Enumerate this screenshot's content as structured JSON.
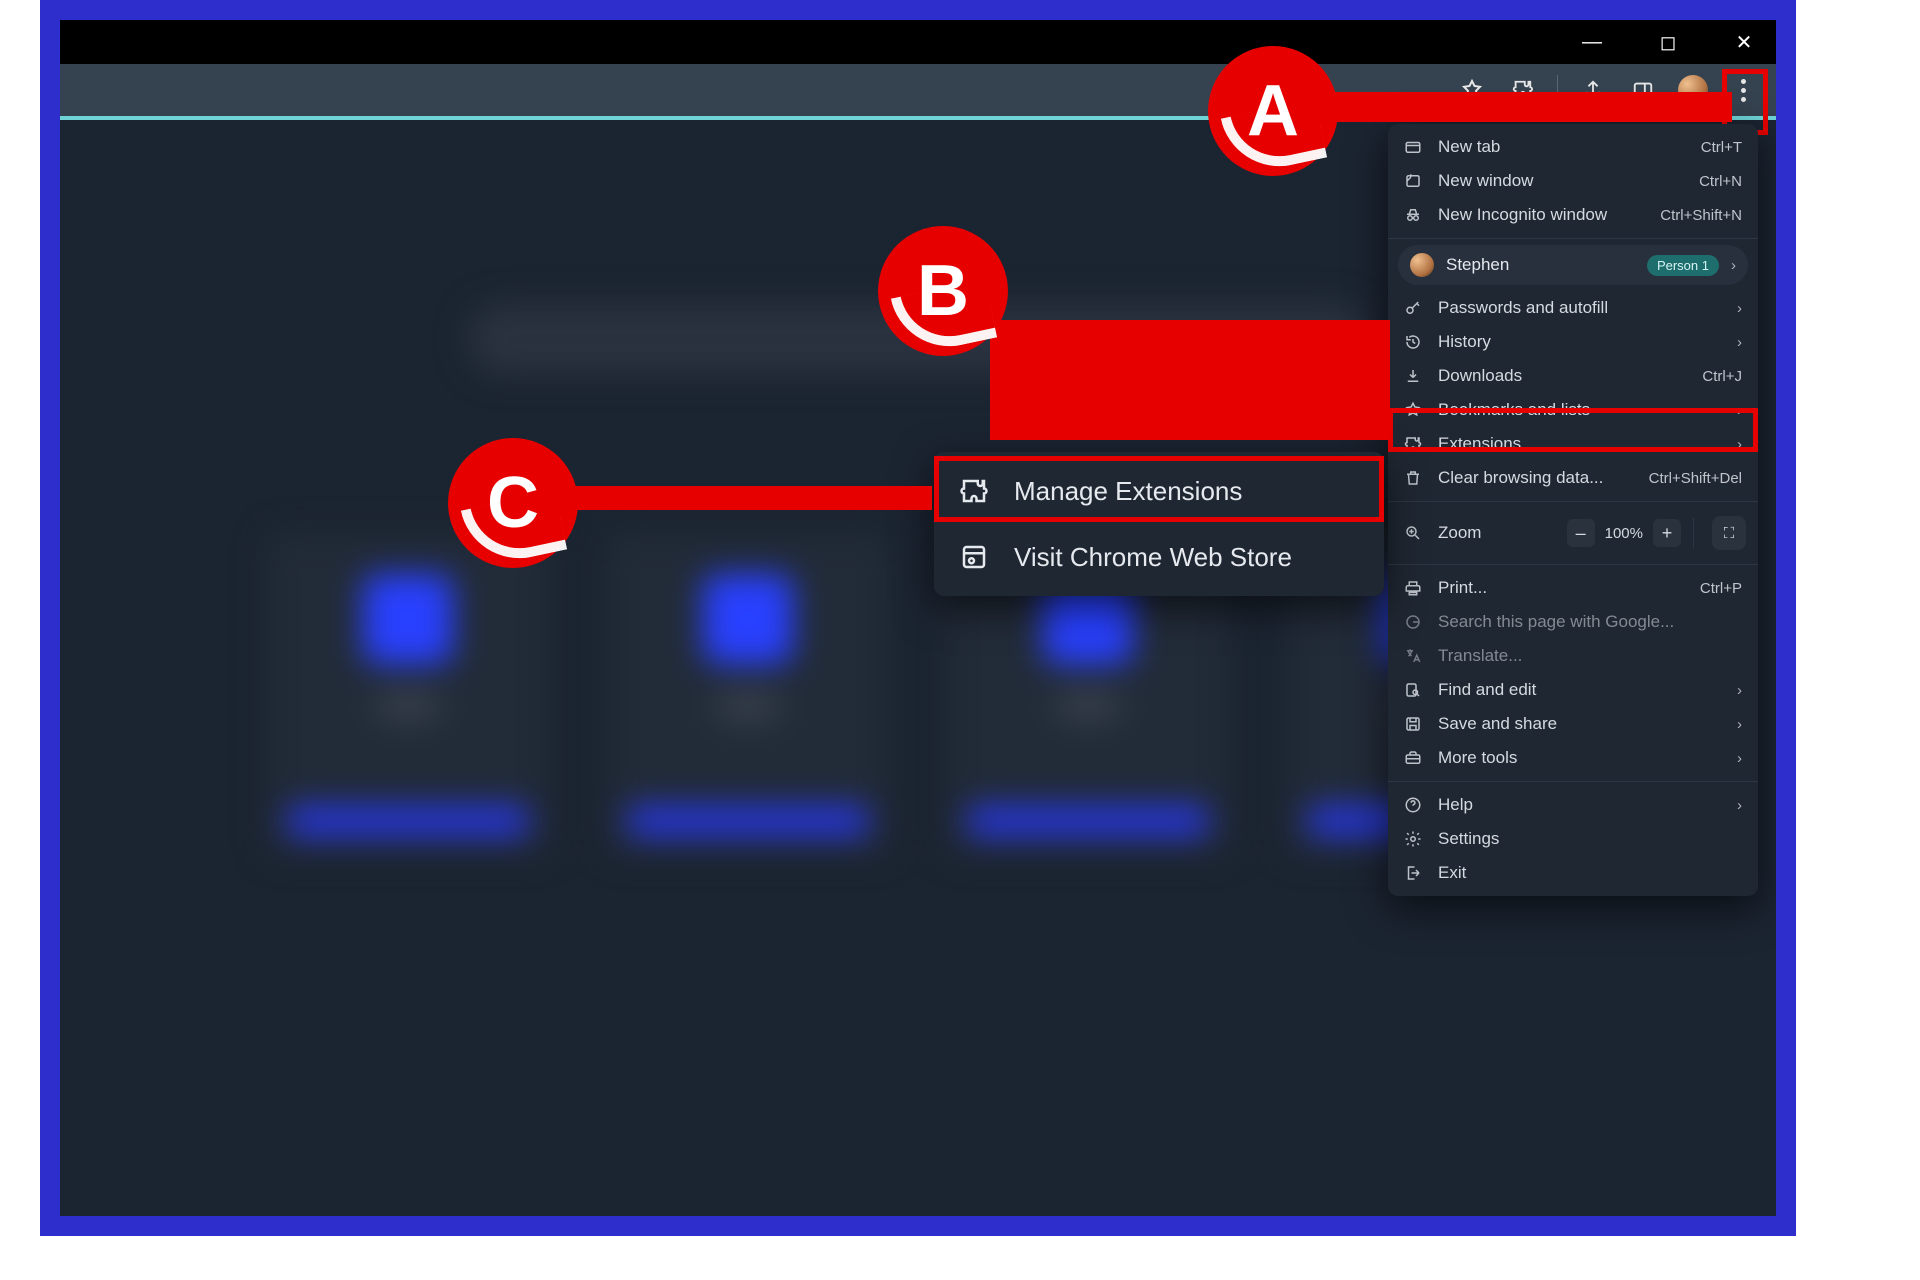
{
  "window_controls": {
    "min": "—",
    "max": "◻",
    "close": "✕"
  },
  "callouts": {
    "a": "A",
    "b": "B",
    "c": "C"
  },
  "submenu": {
    "manage": "Manage Extensions",
    "store": "Visit Chrome Web Store"
  },
  "profile": {
    "name": "Stephen",
    "badge": "Person 1"
  },
  "zoom": {
    "label": "Zoom",
    "value": "100%",
    "minus": "–",
    "plus": "+"
  },
  "menu": {
    "new_tab": {
      "label": "New tab",
      "shortcut": "Ctrl+T"
    },
    "new_window": {
      "label": "New window",
      "shortcut": "Ctrl+N"
    },
    "incognito": {
      "label": "New Incognito window",
      "shortcut": "Ctrl+Shift+N"
    },
    "passwords": {
      "label": "Passwords and autofill"
    },
    "history": {
      "label": "History"
    },
    "downloads": {
      "label": "Downloads",
      "shortcut": "Ctrl+J"
    },
    "bookmarks": {
      "label": "Bookmarks and lists"
    },
    "extensions": {
      "label": "Extensions"
    },
    "clear": {
      "label": "Clear browsing data...",
      "shortcut": "Ctrl+Shift+Del"
    },
    "print": {
      "label": "Print...",
      "shortcut": "Ctrl+P"
    },
    "search_google": {
      "label": "Search this page with Google..."
    },
    "translate": {
      "label": "Translate..."
    },
    "find": {
      "label": "Find and edit"
    },
    "save_share": {
      "label": "Save and share"
    },
    "more_tools": {
      "label": "More tools"
    },
    "help": {
      "label": "Help"
    },
    "settings": {
      "label": "Settings"
    },
    "exit": {
      "label": "Exit"
    }
  }
}
